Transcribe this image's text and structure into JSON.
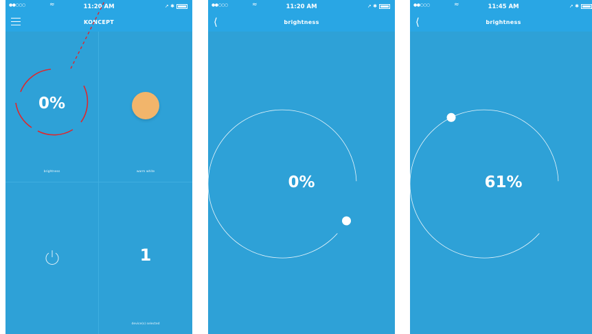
{
  "screens": [
    {
      "status": {
        "signal": "●●○○○",
        "time": "11:20 AM",
        "icons": "➚ ✱"
      },
      "nav": {
        "title": "KONCEPT"
      },
      "tiles": {
        "brightness_value": "0%",
        "brightness_label": "brightness",
        "warm_label": "warm white",
        "count_value": "1",
        "count_label": "device(s) selected"
      },
      "colors": {
        "warm_white": "#f2b56b",
        "annotation": "#e0262b"
      }
    },
    {
      "status": {
        "signal": "●●○○○",
        "time": "11:20 AM",
        "icons": "➚ ✱"
      },
      "nav": {
        "title": "brightness"
      },
      "dial": {
        "value_text": "0%",
        "level": 0
      }
    },
    {
      "status": {
        "signal": "●●○○○",
        "time": "11:45 AM",
        "icons": "➚ ✱"
      },
      "nav": {
        "title": "brightness"
      },
      "dial": {
        "value_text": "61%",
        "level": 0.61
      }
    }
  ],
  "colors": {
    "background": "#2ea1d7",
    "bar": "#29a6e4",
    "track": "#ffffff"
  }
}
